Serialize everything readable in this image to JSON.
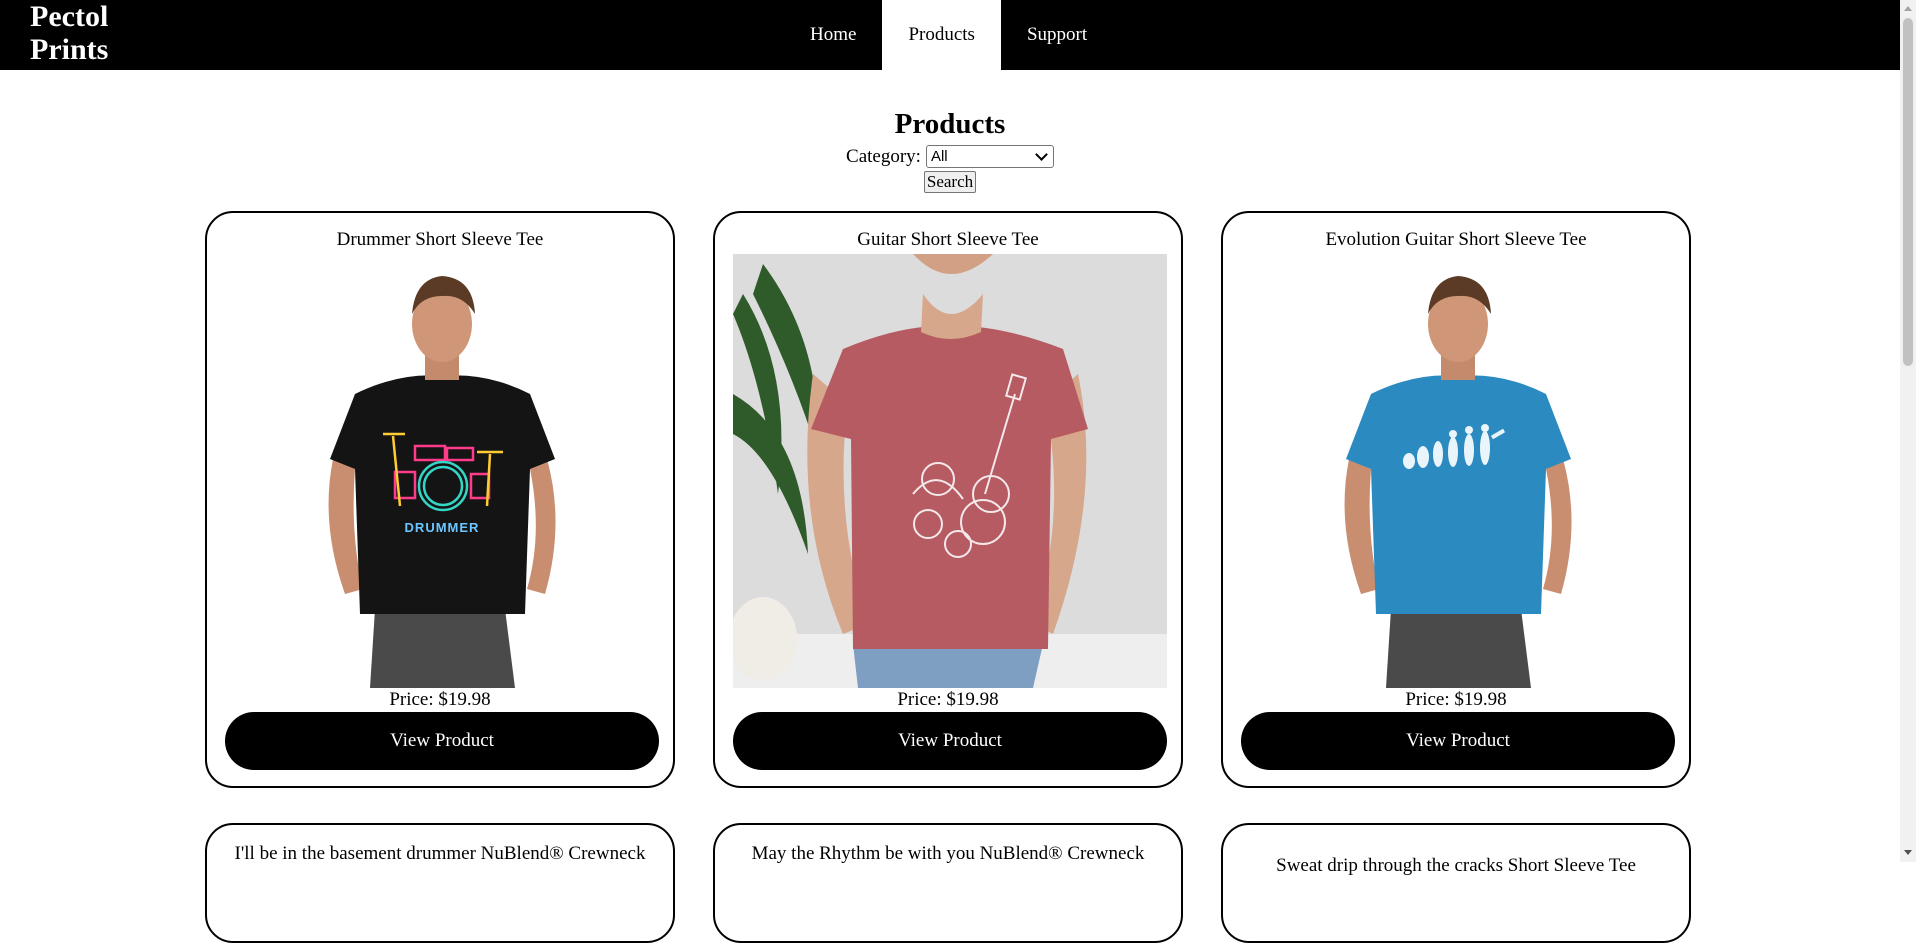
{
  "brand": {
    "name": "Pectol Prints"
  },
  "nav": {
    "tabs": [
      {
        "label": "Home"
      },
      {
        "label": "Products",
        "active": true
      },
      {
        "label": "Support"
      }
    ]
  },
  "page": {
    "title": "Products",
    "filter": {
      "label": "Category:",
      "selected": "All",
      "search_label": "Search"
    }
  },
  "products": [
    {
      "name": "Drummer Short Sleeve Tee",
      "price": "Price: $19.98",
      "button": "View Product",
      "shirt_color": "#141414"
    },
    {
      "name": "Guitar Short Sleeve Tee",
      "price": "Price: $19.98",
      "button": "View Product",
      "shirt_color": "#b55b61"
    },
    {
      "name": "Evolution Guitar Short Sleeve Tee",
      "price": "Price: $19.98",
      "button": "View Product",
      "shirt_color": "#2b8bc0"
    },
    {
      "name": "I'll be in the basement drummer NuBlend® Crewneck"
    },
    {
      "name": "May the Rhythm be with you NuBlend® Crewneck"
    },
    {
      "name": "Sweat drip through the cracks Short Sleeve Tee"
    }
  ],
  "colors": {
    "header_bg": "#000000",
    "button_bg": "#000000",
    "accent_text": "#ffffff"
  }
}
